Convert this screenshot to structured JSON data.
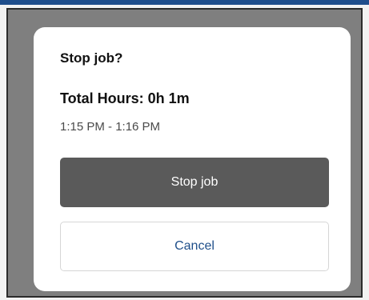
{
  "dialog": {
    "title": "Stop job?",
    "total_hours": "Total Hours: 0h 1m",
    "time_range": "1:15 PM - 1:16 PM",
    "stop_label": "Stop job",
    "cancel_label": "Cancel"
  },
  "colors": {
    "overlay": "#7f7f7f",
    "dialog_background": "#ffffff",
    "primary_button": "#5a5a5a",
    "cancel_text": "#1f4f8a",
    "top_accent": "#1f4e8c"
  }
}
